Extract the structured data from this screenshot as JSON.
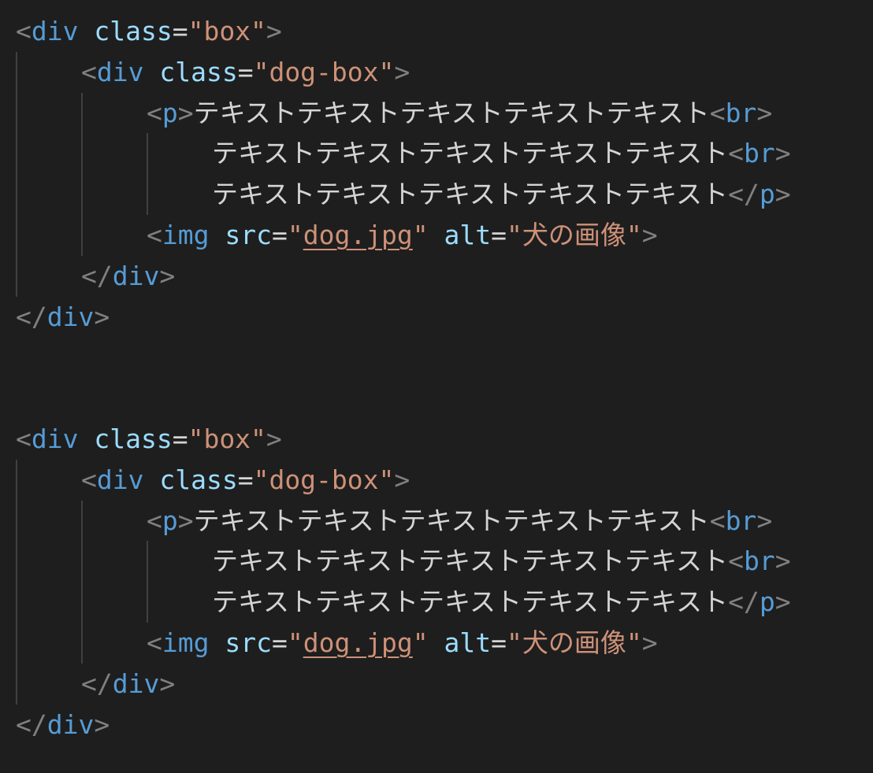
{
  "editor": {
    "language": "html",
    "colors": {
      "background": "#1e1e1e",
      "bracket": "#808080",
      "tag": "#569cd6",
      "attribute": "#9cdcfe",
      "string": "#ce9178",
      "text": "#d4d4d4",
      "indent_guide": "#404040"
    },
    "lines": [
      {
        "indent": 0,
        "tokens": [
          [
            "bracket",
            "<"
          ],
          [
            "tag",
            "div"
          ],
          [
            "text",
            " "
          ],
          [
            "attr",
            "class"
          ],
          [
            "eq",
            "="
          ],
          [
            "str",
            "\"box\""
          ],
          [
            "bracket",
            ">"
          ]
        ]
      },
      {
        "indent": 1,
        "tokens": [
          [
            "bracket",
            "<"
          ],
          [
            "tag",
            "div"
          ],
          [
            "text",
            " "
          ],
          [
            "attr",
            "class"
          ],
          [
            "eq",
            "="
          ],
          [
            "str",
            "\"dog-box\""
          ],
          [
            "bracket",
            ">"
          ]
        ]
      },
      {
        "indent": 2,
        "tokens": [
          [
            "bracket",
            "<"
          ],
          [
            "tag",
            "p"
          ],
          [
            "bracket",
            ">"
          ],
          [
            "text",
            "テキストテキストテキストテキストテキスト"
          ],
          [
            "bracket",
            "<"
          ],
          [
            "tag",
            "br"
          ],
          [
            "bracket",
            ">"
          ]
        ]
      },
      {
        "indent": 3,
        "tokens": [
          [
            "text",
            "テキストテキストテキストテキストテキスト"
          ],
          [
            "bracket",
            "<"
          ],
          [
            "tag",
            "br"
          ],
          [
            "bracket",
            ">"
          ]
        ]
      },
      {
        "indent": 3,
        "tokens": [
          [
            "text",
            "テキストテキストテキストテキストテキスト"
          ],
          [
            "bracket",
            "</"
          ],
          [
            "tag",
            "p"
          ],
          [
            "bracket",
            ">"
          ]
        ]
      },
      {
        "indent": 2,
        "tokens": [
          [
            "bracket",
            "<"
          ],
          [
            "tag",
            "img"
          ],
          [
            "text",
            " "
          ],
          [
            "attr",
            "src"
          ],
          [
            "eq",
            "="
          ],
          [
            "str",
            "\""
          ],
          [
            "link",
            "dog.jpg"
          ],
          [
            "str",
            "\""
          ],
          [
            "text",
            " "
          ],
          [
            "attr",
            "alt"
          ],
          [
            "eq",
            "="
          ],
          [
            "str",
            "\"犬の画像\""
          ],
          [
            "bracket",
            ">"
          ]
        ]
      },
      {
        "indent": 1,
        "tokens": [
          [
            "bracket",
            "</"
          ],
          [
            "tag",
            "div"
          ],
          [
            "bracket",
            ">"
          ]
        ]
      },
      {
        "indent": 0,
        "tokens": [
          [
            "bracket",
            "</"
          ],
          [
            "tag",
            "div"
          ],
          [
            "bracket",
            ">"
          ]
        ]
      },
      {
        "indent": 0,
        "tokens": []
      },
      {
        "indent": 0,
        "tokens": []
      },
      {
        "indent": 0,
        "tokens": [
          [
            "bracket",
            "<"
          ],
          [
            "tag",
            "div"
          ],
          [
            "text",
            " "
          ],
          [
            "attr",
            "class"
          ],
          [
            "eq",
            "="
          ],
          [
            "str",
            "\"box\""
          ],
          [
            "bracket",
            ">"
          ]
        ]
      },
      {
        "indent": 1,
        "tokens": [
          [
            "bracket",
            "<"
          ],
          [
            "tag",
            "div"
          ],
          [
            "text",
            " "
          ],
          [
            "attr",
            "class"
          ],
          [
            "eq",
            "="
          ],
          [
            "str",
            "\"dog-box\""
          ],
          [
            "bracket",
            ">"
          ]
        ]
      },
      {
        "indent": 2,
        "tokens": [
          [
            "bracket",
            "<"
          ],
          [
            "tag",
            "p"
          ],
          [
            "bracket",
            ">"
          ],
          [
            "text",
            "テキストテキストテキストテキストテキスト"
          ],
          [
            "bracket",
            "<"
          ],
          [
            "tag",
            "br"
          ],
          [
            "bracket",
            ">"
          ]
        ]
      },
      {
        "indent": 3,
        "tokens": [
          [
            "text",
            "テキストテキストテキストテキストテキスト"
          ],
          [
            "bracket",
            "<"
          ],
          [
            "tag",
            "br"
          ],
          [
            "bracket",
            ">"
          ]
        ]
      },
      {
        "indent": 3,
        "tokens": [
          [
            "text",
            "テキストテキストテキストテキストテキスト"
          ],
          [
            "bracket",
            "</"
          ],
          [
            "tag",
            "p"
          ],
          [
            "bracket",
            ">"
          ]
        ]
      },
      {
        "indent": 2,
        "tokens": [
          [
            "bracket",
            "<"
          ],
          [
            "tag",
            "img"
          ],
          [
            "text",
            " "
          ],
          [
            "attr",
            "src"
          ],
          [
            "eq",
            "="
          ],
          [
            "str",
            "\""
          ],
          [
            "link",
            "dog.jpg"
          ],
          [
            "str",
            "\""
          ],
          [
            "text",
            " "
          ],
          [
            "attr",
            "alt"
          ],
          [
            "eq",
            "="
          ],
          [
            "str",
            "\"犬の画像\""
          ],
          [
            "bracket",
            ">"
          ]
        ]
      },
      {
        "indent": 1,
        "tokens": [
          [
            "bracket",
            "</"
          ],
          [
            "tag",
            "div"
          ],
          [
            "bracket",
            ">"
          ]
        ]
      },
      {
        "indent": 0,
        "tokens": [
          [
            "bracket",
            "</"
          ],
          [
            "tag",
            "div"
          ],
          [
            "bracket",
            ">"
          ]
        ]
      }
    ]
  }
}
